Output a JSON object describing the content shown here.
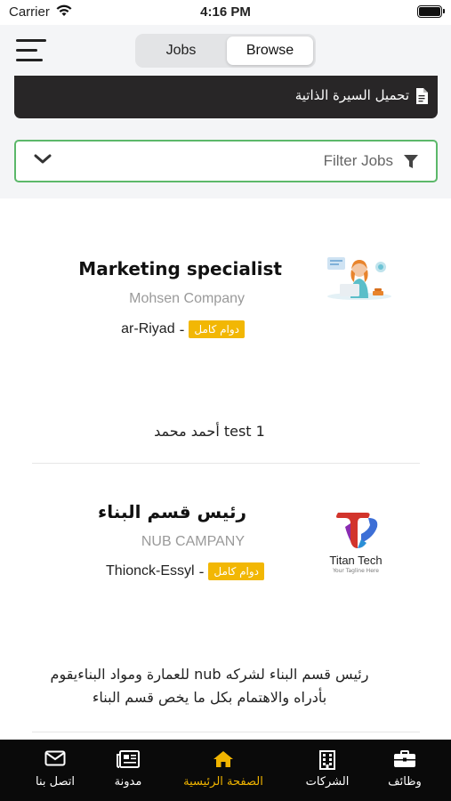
{
  "status_bar": {
    "carrier": "Carrier",
    "time": "4:16 PM"
  },
  "header": {
    "segments": [
      "Jobs",
      "Browse"
    ],
    "active_segment": "Browse"
  },
  "cv_upload": {
    "label": "تحميل السيرة الذاتية"
  },
  "filter": {
    "label": "Filter Jobs"
  },
  "jobs": [
    {
      "title": "Marketing specialist",
      "company": "Mohsen Company",
      "location": "ar-Riyad",
      "type": "دوام كامل",
      "description": "test 1 أحمد محمد",
      "logo": "customer-service-illustration"
    },
    {
      "title": "رئيس قسم البناء",
      "company": "NUB CAMPANY",
      "location": "Thionck-Essyl",
      "type": "دوام كامل",
      "description": "رئيس قسم البناء لشركه nub للعمارة ومواد البناءيقوم بأدراه والاهتمام بكل ما يخص قسم البناء",
      "logo": "titan-tech-logo",
      "logo_text": "Titan Tech",
      "logo_tagline": "Your Tagline Here"
    }
  ],
  "tabbar": {
    "items": [
      {
        "label": "اتصل بنا",
        "icon": "mail-icon"
      },
      {
        "label": "مدونة",
        "icon": "newspaper-icon"
      },
      {
        "label": "الصفحة الرئيسية",
        "icon": "home-icon"
      },
      {
        "label": "الشركات",
        "icon": "building-icon"
      },
      {
        "label": "وظائف",
        "icon": "briefcase-icon"
      }
    ],
    "active": "الصفحة الرئيسية"
  },
  "colors": {
    "accent": "#f0b400",
    "filter_border": "#5cb86a",
    "badge": "#f2b704",
    "tabbar_bg": "#0a0a0a",
    "cv_bar_bg": "#282627"
  }
}
